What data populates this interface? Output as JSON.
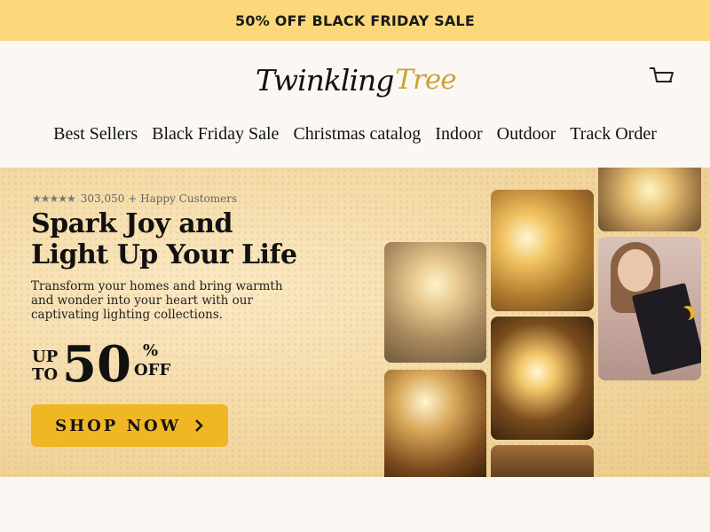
{
  "announcement": {
    "text": "50% OFF BLACK FRIDAY SALE"
  },
  "brand": {
    "name_part1": "Twinkling",
    "name_part2": "Tree"
  },
  "nav": {
    "items": [
      "Best Sellers",
      "Black Friday Sale",
      "Christmas catalog",
      "Indoor",
      "Outdoor",
      "Track Order"
    ]
  },
  "hero": {
    "stars": "★★★★★",
    "rating_value": 4.5,
    "rating_text": "303,050 + Happy Customers",
    "headline_line1": "Spark Joy and",
    "headline_line2": "Light Up Your Life",
    "subtext": "Transform your homes and bring warmth and wonder into your heart with our captivating lighting collections.",
    "offer_up": "UP",
    "offer_to": "TO",
    "offer_number": "50",
    "offer_percent": "%",
    "offer_off": "OFF",
    "cta_label": "SHOP NOW"
  },
  "colors": {
    "announcement_bg": "#fcd87a",
    "cta_bg": "#f0b624",
    "brand_gold": "#c9a23a"
  },
  "icons": {
    "cart": "cart-icon",
    "logo_tree": "tree-moon-icon",
    "cta_arrow": "chevron-right-icon",
    "stars": "star-icon"
  }
}
